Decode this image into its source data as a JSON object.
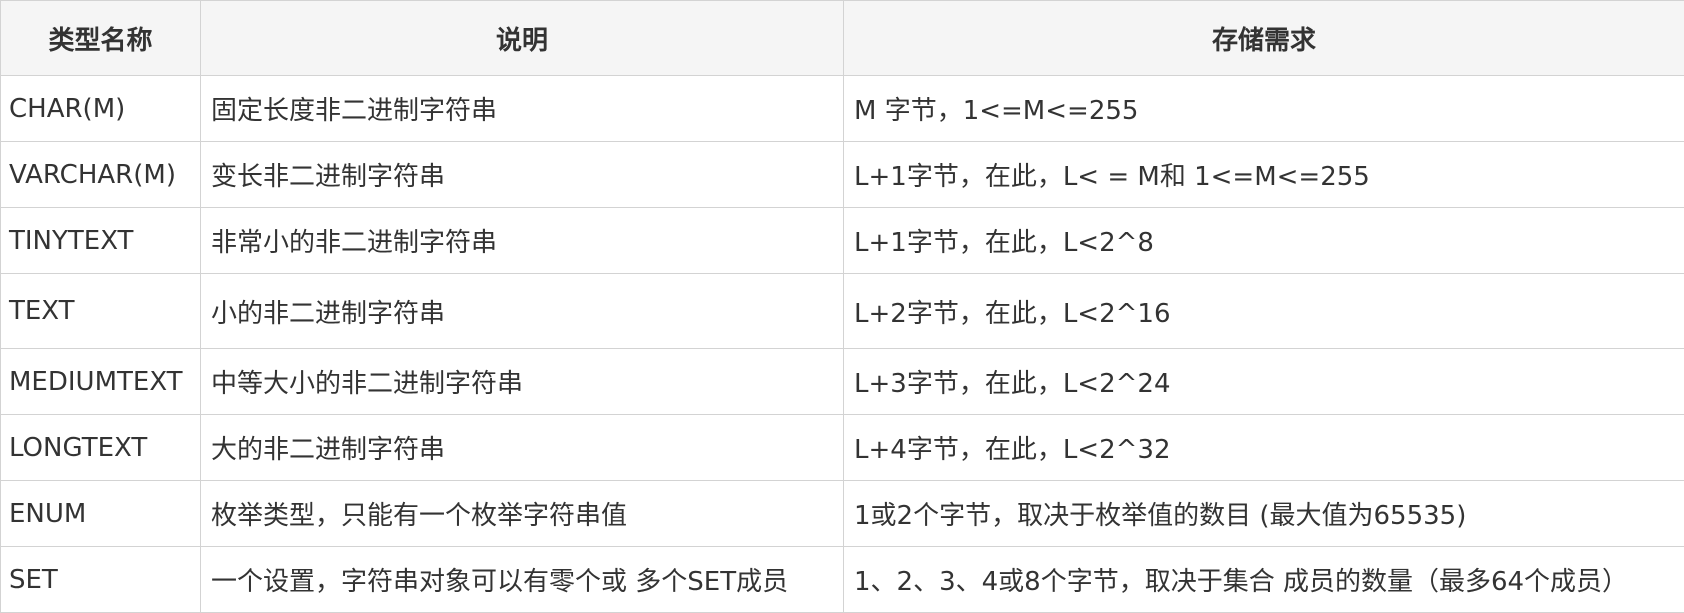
{
  "table": {
    "headers": [
      "类型名称",
      "说明",
      "存储需求"
    ],
    "rows": [
      [
        "CHAR(M)",
        "固定长度非二进制字符串",
        "M 字节，1<=M<=255"
      ],
      [
        "VARCHAR(M)",
        "变长非二进制字符串",
        "L+1字节，在此，L< = M和 1<=M<=255"
      ],
      [
        "TINYTEXT",
        "非常小的非二进制字符串",
        "L+1字节，在此，L<2^8"
      ],
      [
        "TEXT",
        "小的非二进制字符串",
        "L+2字节，在此，L<2^16"
      ],
      [
        "MEDIUMTEXT",
        "中等大小的非二进制字符串",
        "L+3字节，在此，L<2^24"
      ],
      [
        "LONGTEXT",
        "大的非二进制字符串",
        "L+4字节，在此，L<2^32"
      ],
      [
        "ENUM",
        "枚举类型，只能有一个枚举字符串值",
        "1或2个字节，取决于枚举值的数目 (最大值为65535)"
      ],
      [
        "SET",
        "一个设置，字符串对象可以有零个或 多个SET成员",
        "1、2、3、4或8个字节，取决于集合 成员的数量（最多64个成员）"
      ]
    ]
  }
}
